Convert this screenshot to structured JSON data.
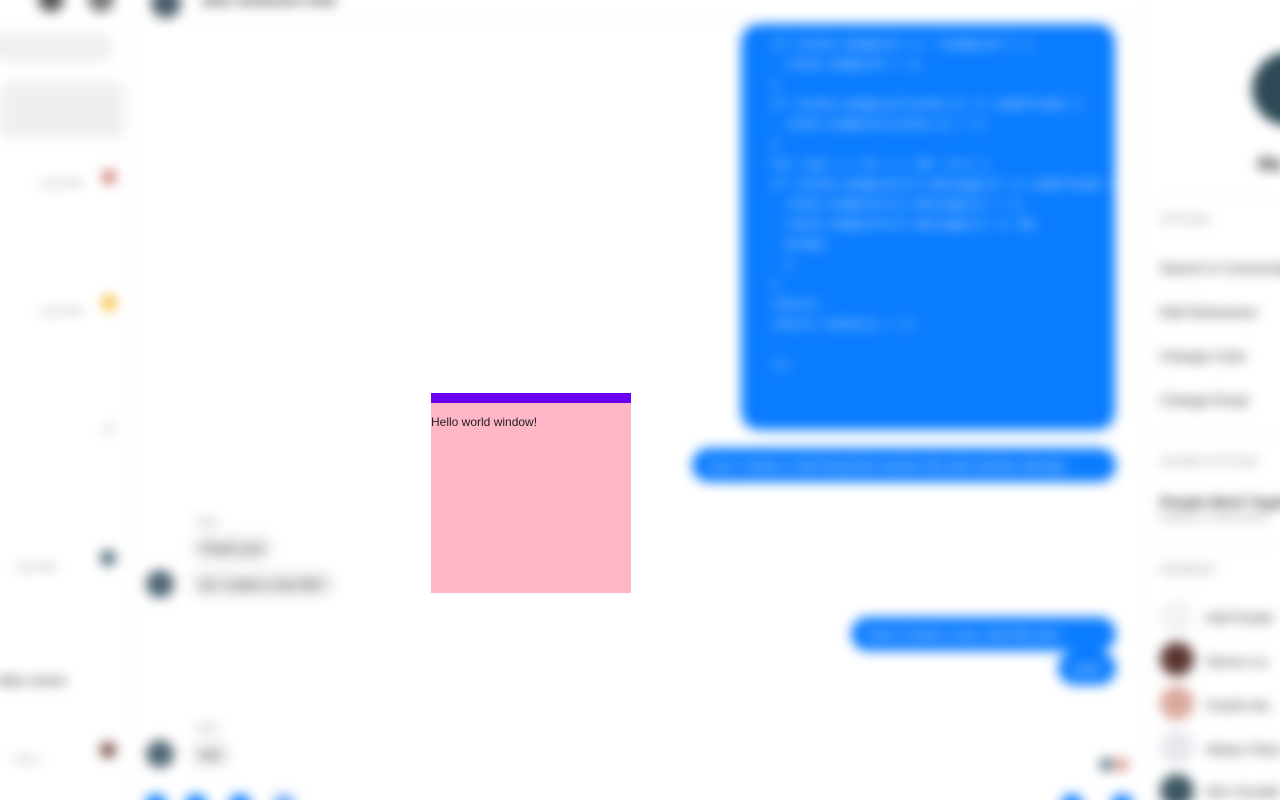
{
  "popup": {
    "body_text": "Hello world window!",
    "titlebar_color": "#6a00f4",
    "background_color": "#ffb6c6"
  },
  "header": {
    "chat_title": "Jack Jonassen Chat"
  },
  "sidebar_left": {
    "conversations": [
      {
        "meta": "· 1:02 PM"
      },
      {
        "meta": "· 1:01 PM"
      },
      {
        "meta": "· 1:00 PM"
      },
      {
        "title": "atlas series",
        "meta": "· Oct 1"
      }
    ]
  },
  "messages": {
    "code_block": "  if (state.endpoint == ‘/endpoint’) {\n    state.endpoint = 1;\n  }\n  if (state.endpoint[state.x] == undefined) {\n    state.endpoint[state.x] = 1;\n  }\n  for (var i = 0; i < 10; i++) {\n  if (state.endpoint[i].message[i] == undefined) {\n    state.endpoint[i].message[i] = 1;\n    state.endpoint[i].message[i] += 10;\n    break;\n    }\n  }\n  return;\n  return state[i] + 1;\n\n  ));",
    "outgoing_1": "Can I create a chat thing that renders the pink window already",
    "incoming_sender_1": "Sam",
    "incoming_1a": "Thank you!",
    "incoming_1b": "So I made a new file?",
    "outgoing_2": "Sure! Create a new .html file and...",
    "outgoing_3": "yeah",
    "incoming_sender_2": "Sam",
    "incoming_2": "test"
  },
  "sidebar_right": {
    "name": "Ma",
    "options_heading": "OPTIONS",
    "options": [
      "Search in Conversation",
      "Edit Nicknames",
      "Change Color",
      "Change Emoji"
    ],
    "shared_heading": "SHARED OPTIONS",
    "shared_title": "People Work Together",
    "shared_sub": "Repeat or share items",
    "members_heading": "MEMBERS",
    "members": [
      {
        "name": "Add People"
      },
      {
        "name": "Steven Liu"
      },
      {
        "name": "Charlie Wu"
      },
      {
        "name": "Weijun Pakul"
      },
      {
        "name": "Alex Goodall"
      }
    ]
  }
}
